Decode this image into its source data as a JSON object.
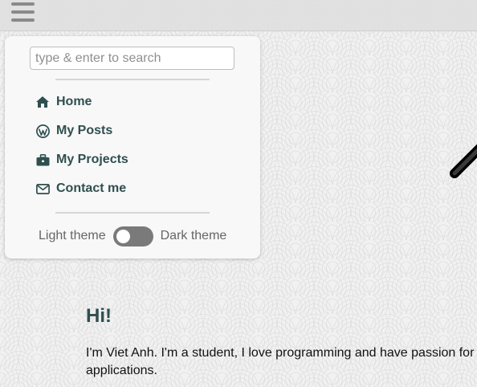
{
  "header": {
    "menu_icon": "hamburger-menu-icon"
  },
  "menu": {
    "search": {
      "placeholder": "type & enter to search",
      "value": ""
    },
    "items": [
      {
        "label": "Home",
        "icon": "home-icon"
      },
      {
        "label": "My Posts",
        "icon": "wordpress-icon"
      },
      {
        "label": "My Projects",
        "icon": "briefcase-icon"
      },
      {
        "label": "Contact me",
        "icon": "envelope-icon"
      }
    ],
    "theme": {
      "light_label": "Light theme",
      "dark_label": "Dark theme",
      "dark_enabled": false
    }
  },
  "main": {
    "greeting": "Hi!",
    "intro_line1": "I'm Viet Anh. I'm a student, I love programming and have passion for",
    "intro_line2": "applications."
  },
  "colors": {
    "accent": "#2f4f4f",
    "toggle": "#7a7a7a",
    "background": "#f1f1f1"
  }
}
